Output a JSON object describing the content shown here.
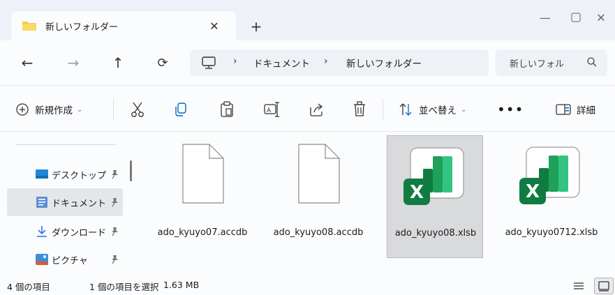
{
  "window": {
    "tab_title": "新しいフォルダー"
  },
  "address": {
    "crumbs": [
      "ドキュメント",
      "新しいフォルダー"
    ],
    "search_placeholder": "新しいフォル"
  },
  "commands": {
    "new_label": "新規作成",
    "sort_label": "並べ替え",
    "details_label": "詳細"
  },
  "sidebar": {
    "items": [
      {
        "label": "デスクトップ",
        "icon": "desktop-icon",
        "selected": false
      },
      {
        "label": "ドキュメント",
        "icon": "documents-icon",
        "selected": true
      },
      {
        "label": "ダウンロード",
        "icon": "download-icon",
        "selected": false
      },
      {
        "label": "ピクチャ",
        "icon": "pictures-icon",
        "selected": false
      }
    ]
  },
  "files": [
    {
      "name": "ado_kyuyo07.accdb",
      "type": "generic",
      "selected": false
    },
    {
      "name": "ado_kyuyo08.accdb",
      "type": "generic",
      "selected": false
    },
    {
      "name": "ado_kyuyo08.xlsb",
      "type": "excel",
      "selected": true
    },
    {
      "name": "ado_kyuyo0712.xlsb",
      "type": "excel",
      "selected": false
    }
  ],
  "status": {
    "count": "4 個の項目",
    "selection": "1 個の項目を選択",
    "size": "1.63 MB"
  },
  "colors": {
    "excel_green": "#107c41",
    "folder_yellow": "#f7c948",
    "accent": "#0067c0"
  }
}
